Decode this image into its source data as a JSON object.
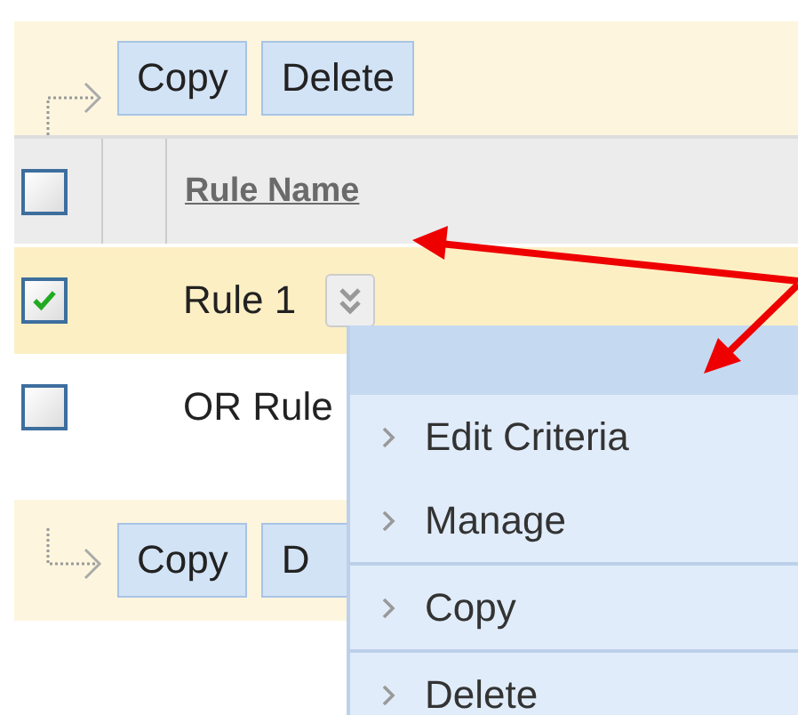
{
  "top_toolbar": {
    "buttons": [
      "Copy",
      "Delete"
    ]
  },
  "table": {
    "header": {
      "checked": false,
      "column": "Rule Name"
    },
    "rows": [
      {
        "name": "Rule 1",
        "checked": true,
        "selected": true,
        "context_menu": {
          "items": [
            {
              "label": "Edit Criteria",
              "separator_above": false
            },
            {
              "label": "Manage",
              "separator_above": false
            },
            {
              "label": "Copy",
              "separator_above": true
            },
            {
              "label": "Delete",
              "separator_above": true
            }
          ]
        }
      },
      {
        "name": "OR Rule",
        "checked": false,
        "selected": false
      }
    ]
  },
  "bottom_toolbar": {
    "buttons": [
      "Copy",
      "D"
    ]
  }
}
